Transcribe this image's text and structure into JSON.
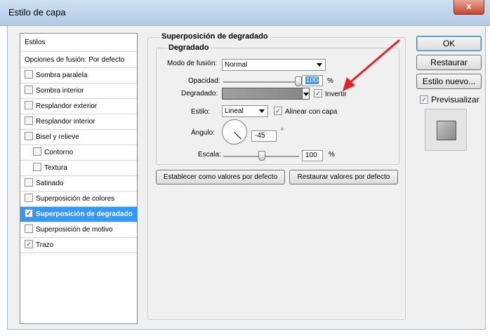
{
  "window": {
    "title": "Estilo de capa",
    "close_glyph": "x"
  },
  "styles_panel": {
    "header": "Estilos",
    "items": [
      {
        "label": "Opciones de fusión: Por defecto",
        "checkbox": false,
        "checked": false,
        "selected": false,
        "indent": false
      },
      {
        "label": "Sombra paralela",
        "checkbox": true,
        "checked": false,
        "selected": false,
        "indent": false
      },
      {
        "label": "Sombra interior",
        "checkbox": true,
        "checked": false,
        "selected": false,
        "indent": false
      },
      {
        "label": "Resplandor exterior",
        "checkbox": true,
        "checked": false,
        "selected": false,
        "indent": false
      },
      {
        "label": "Resplandor interior",
        "checkbox": true,
        "checked": false,
        "selected": false,
        "indent": false
      },
      {
        "label": "Bisel y relieve",
        "checkbox": true,
        "checked": false,
        "selected": false,
        "indent": false
      },
      {
        "label": "Contorno",
        "checkbox": true,
        "checked": false,
        "selected": false,
        "indent": true
      },
      {
        "label": "Textura",
        "checkbox": true,
        "checked": false,
        "selected": false,
        "indent": true
      },
      {
        "label": "Satinado",
        "checkbox": true,
        "checked": false,
        "selected": false,
        "indent": false
      },
      {
        "label": "Superposición de colores",
        "checkbox": true,
        "checked": false,
        "selected": false,
        "indent": false
      },
      {
        "label": "Superposición de degradado",
        "checkbox": true,
        "checked": true,
        "selected": true,
        "indent": false
      },
      {
        "label": "Superposición de motivo",
        "checkbox": true,
        "checked": false,
        "selected": false,
        "indent": false
      },
      {
        "label": "Trazo",
        "checkbox": true,
        "checked": true,
        "selected": false,
        "indent": false
      }
    ]
  },
  "gradient_overlay": {
    "section_title": "Superposición de degradado",
    "group_title": "Degradado",
    "blend_mode_label": "Modo de fusión:",
    "blend_mode_value": "Normal",
    "opacity_label": "Opacidad:",
    "opacity_value": "100",
    "opacity_unit": "%",
    "opacity_level": 1.0,
    "gradient_label": "Degradado:",
    "invert_label": "Invertir",
    "invert_checked": true,
    "style_label": "Estilo:",
    "style_value": "Lineal",
    "align_label": "Alinear con capa",
    "align_checked": true,
    "angle_label": "Ángulo:",
    "angle_value": "-45",
    "angle_unit": "°",
    "scale_label": "Escala:",
    "scale_value": "100",
    "scale_unit": "%",
    "scale_level": 0.5,
    "make_default_button": "Establecer como valores por defecto",
    "reset_default_button": "Restaurar valores por defecto"
  },
  "buttons": {
    "ok": "OK",
    "reset": "Restaurar",
    "new_style": "Estilo nuevo...",
    "preview_label": "Previsualizar",
    "preview_checked": true
  },
  "colors": {
    "selection": "#3399ff",
    "annotation_arrow": "#e8231f",
    "gradient_start": "#a0a0a0",
    "gradient_end": "#888888"
  }
}
